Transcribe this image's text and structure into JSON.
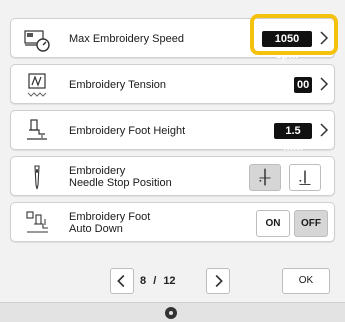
{
  "settings": {
    "items": [
      {
        "label": "Max Embroidery Speed",
        "value": "1050 spm",
        "icon": "embroidery-speed-icon",
        "highlighted": true
      },
      {
        "label": "Embroidery Tension",
        "value": "00",
        "icon": "tension-icon"
      },
      {
        "label": "Embroidery Foot Height",
        "value": "1.5 mm",
        "icon": "foot-height-icon"
      },
      {
        "label_line1": "Embroidery",
        "label_line2": "Needle Stop Position",
        "icon": "needle-icon",
        "options": [
          "needle-up",
          "needle-down"
        ],
        "selected": "needle-up"
      },
      {
        "label_line1": "Embroidery Foot",
        "label_line2": "Auto Down",
        "icon": "foot-auto-down-icon",
        "on_label": "ON",
        "off_label": "OFF",
        "selected": "OFF"
      }
    ]
  },
  "footer": {
    "page_current": "8",
    "page_separator": "/",
    "page_total": "12",
    "ok_label": "OK"
  },
  "colors": {
    "highlight": "#f4c20d",
    "value_bg": "#111111"
  },
  "bottombar": {
    "icon": "sewing-machine-icon"
  }
}
